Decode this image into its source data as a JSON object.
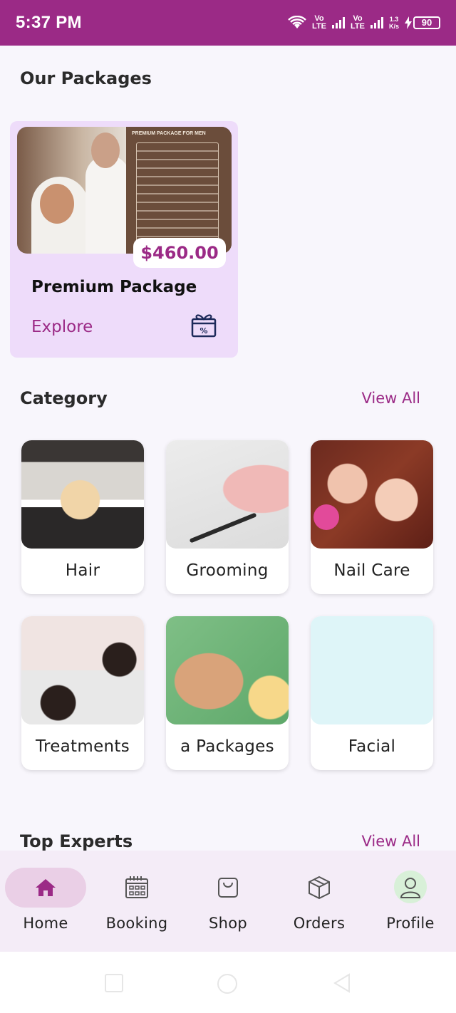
{
  "status_bar": {
    "time": "5:37 PM",
    "network1": "Vo\nLTE",
    "network2": "Vo\nLTE",
    "speed_value": "1.3",
    "speed_unit": "K/s",
    "battery": "90"
  },
  "packages": {
    "title": "Our Packages",
    "card": {
      "poster_title": "PREMIUM PACKAGE FOR MEN",
      "price": "$460.00",
      "name": "Premium Package",
      "explore_label": "Explore",
      "icon": "gift-percent-icon"
    }
  },
  "category": {
    "title": "Category",
    "view_all": "View All",
    "items": [
      {
        "label": "Hair"
      },
      {
        "label": "Grooming"
      },
      {
        "label": "Nail Care"
      },
      {
        "label": "Treatments"
      },
      {
        "label": "a Packages"
      },
      {
        "label": "Facial"
      }
    ]
  },
  "experts": {
    "title": "Top Experts",
    "view_all": "View All"
  },
  "bottom_nav": {
    "accent": "#9b2a86",
    "items": [
      {
        "label": "Home",
        "icon": "home-icon",
        "active": true
      },
      {
        "label": "Booking",
        "icon": "calendar-icon"
      },
      {
        "label": "Shop",
        "icon": "shopping-bag-icon"
      },
      {
        "label": "Orders",
        "icon": "package-box-icon"
      },
      {
        "label": "Profile",
        "icon": "user-icon"
      }
    ]
  },
  "colors": {
    "brand": "#9b2a86",
    "package_card_bg": "#eedcfa",
    "page_bg": "#f8f6fc"
  }
}
